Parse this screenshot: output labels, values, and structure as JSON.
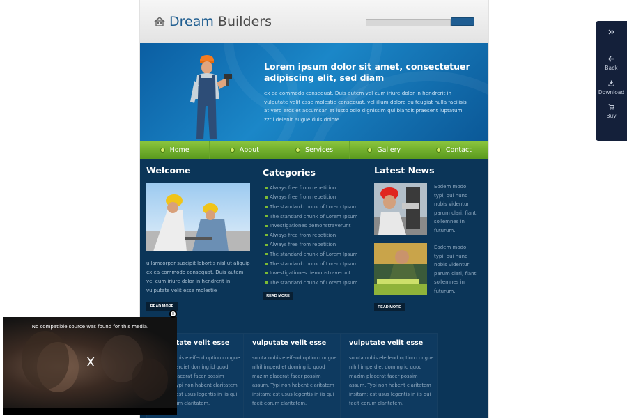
{
  "site": {
    "logo": {
      "part1": "Dream",
      "part2": "Builders",
      "icon": "home-icon"
    },
    "banner": {
      "title": "Lorem ipsum dolor sit amet, consectetuer adipiscing elit, sed diam",
      "body": "ex ea commodo consequat. Duis autem vel eum iriure dolor in hendrerit in vulputate velit esse molestie consequat, vel illum dolore eu feugiat nulla facilisis at vero eros et accumsan et iusto odio dignissim qui blandit praesent luptatum zzril delenit augue duis dolore"
    },
    "nav": [
      "Home",
      "About",
      "Services",
      "Gallery",
      "Contact"
    ],
    "welcome": {
      "heading": "Welcome",
      "text": "ullamcorper suscipit lobortis nisl ut aliquip ex ea commodo consequat. Duis autem vel eum iriure dolor in hendrerit in vulputate velit esse molestie",
      "button": "READ MORE"
    },
    "categories": {
      "heading": "Categories",
      "items": [
        "Always free from repetition",
        "Always free from repetition",
        "The standard chunk of Lorem Ipsum",
        "The standard chunk of Lorem Ipsum",
        "Investigationes demonstraverunt",
        "Always free from repetition",
        "Always free from repetition",
        "The standard chunk of Lorem Ipsum",
        "The standard chunk of Lorem Ipsum",
        "Investigationes demonstraverunt",
        "The standard chunk of Lorem Ipsum"
      ],
      "button": "READ MORE"
    },
    "news": {
      "heading": "Latest News",
      "items": [
        {
          "text": "Eodem modo typi, qui nunc nobis videntur parum clari, fiant sollemnes in futurum."
        },
        {
          "text": "Eodem modo typi, qui nunc nobis videntur parum clari, fiant sollemnes in futurum."
        }
      ],
      "button": "READ MORE"
    },
    "boxes": [
      {
        "title": "vulputate velit esse",
        "text": "soluta nobis eleifend option congue nihil imperdiet doming id quod mazim placerat facer possim assum. Typi non habent claritatem insitam; est usus legentis in iis qui facit eorum claritatem."
      },
      {
        "title": "vulputate velit esse",
        "text": "soluta nobis eleifend option congue nihil imperdiet doming id quod mazim placerat facer possim assum. Typi non habent claritatem insitam; est usus legentis in iis qui facit eorum claritatem."
      },
      {
        "title": "vulputate velit esse",
        "text": "soluta nobis eleifend option congue nihil imperdiet doming id quod mazim placerat facer possim assum. Typi non habent claritatem insitam; est usus legentis in iis qui facit eorum claritatem."
      }
    ]
  },
  "widget": {
    "toggle_icon": "double-chevron-right-icon",
    "items": [
      {
        "label": "Back",
        "icon": "arrow-left-icon"
      },
      {
        "label": "Download",
        "icon": "download-icon"
      },
      {
        "label": "Buy",
        "icon": "cart-icon"
      }
    ]
  },
  "video": {
    "message": "No compatible source was found for this media.",
    "x_mark": "X",
    "close_icon": "close-icon"
  },
  "colors": {
    "brand_blue": "#1d5c8f",
    "nav_green": "#7ab83a",
    "page_bg": "#0b3558"
  }
}
